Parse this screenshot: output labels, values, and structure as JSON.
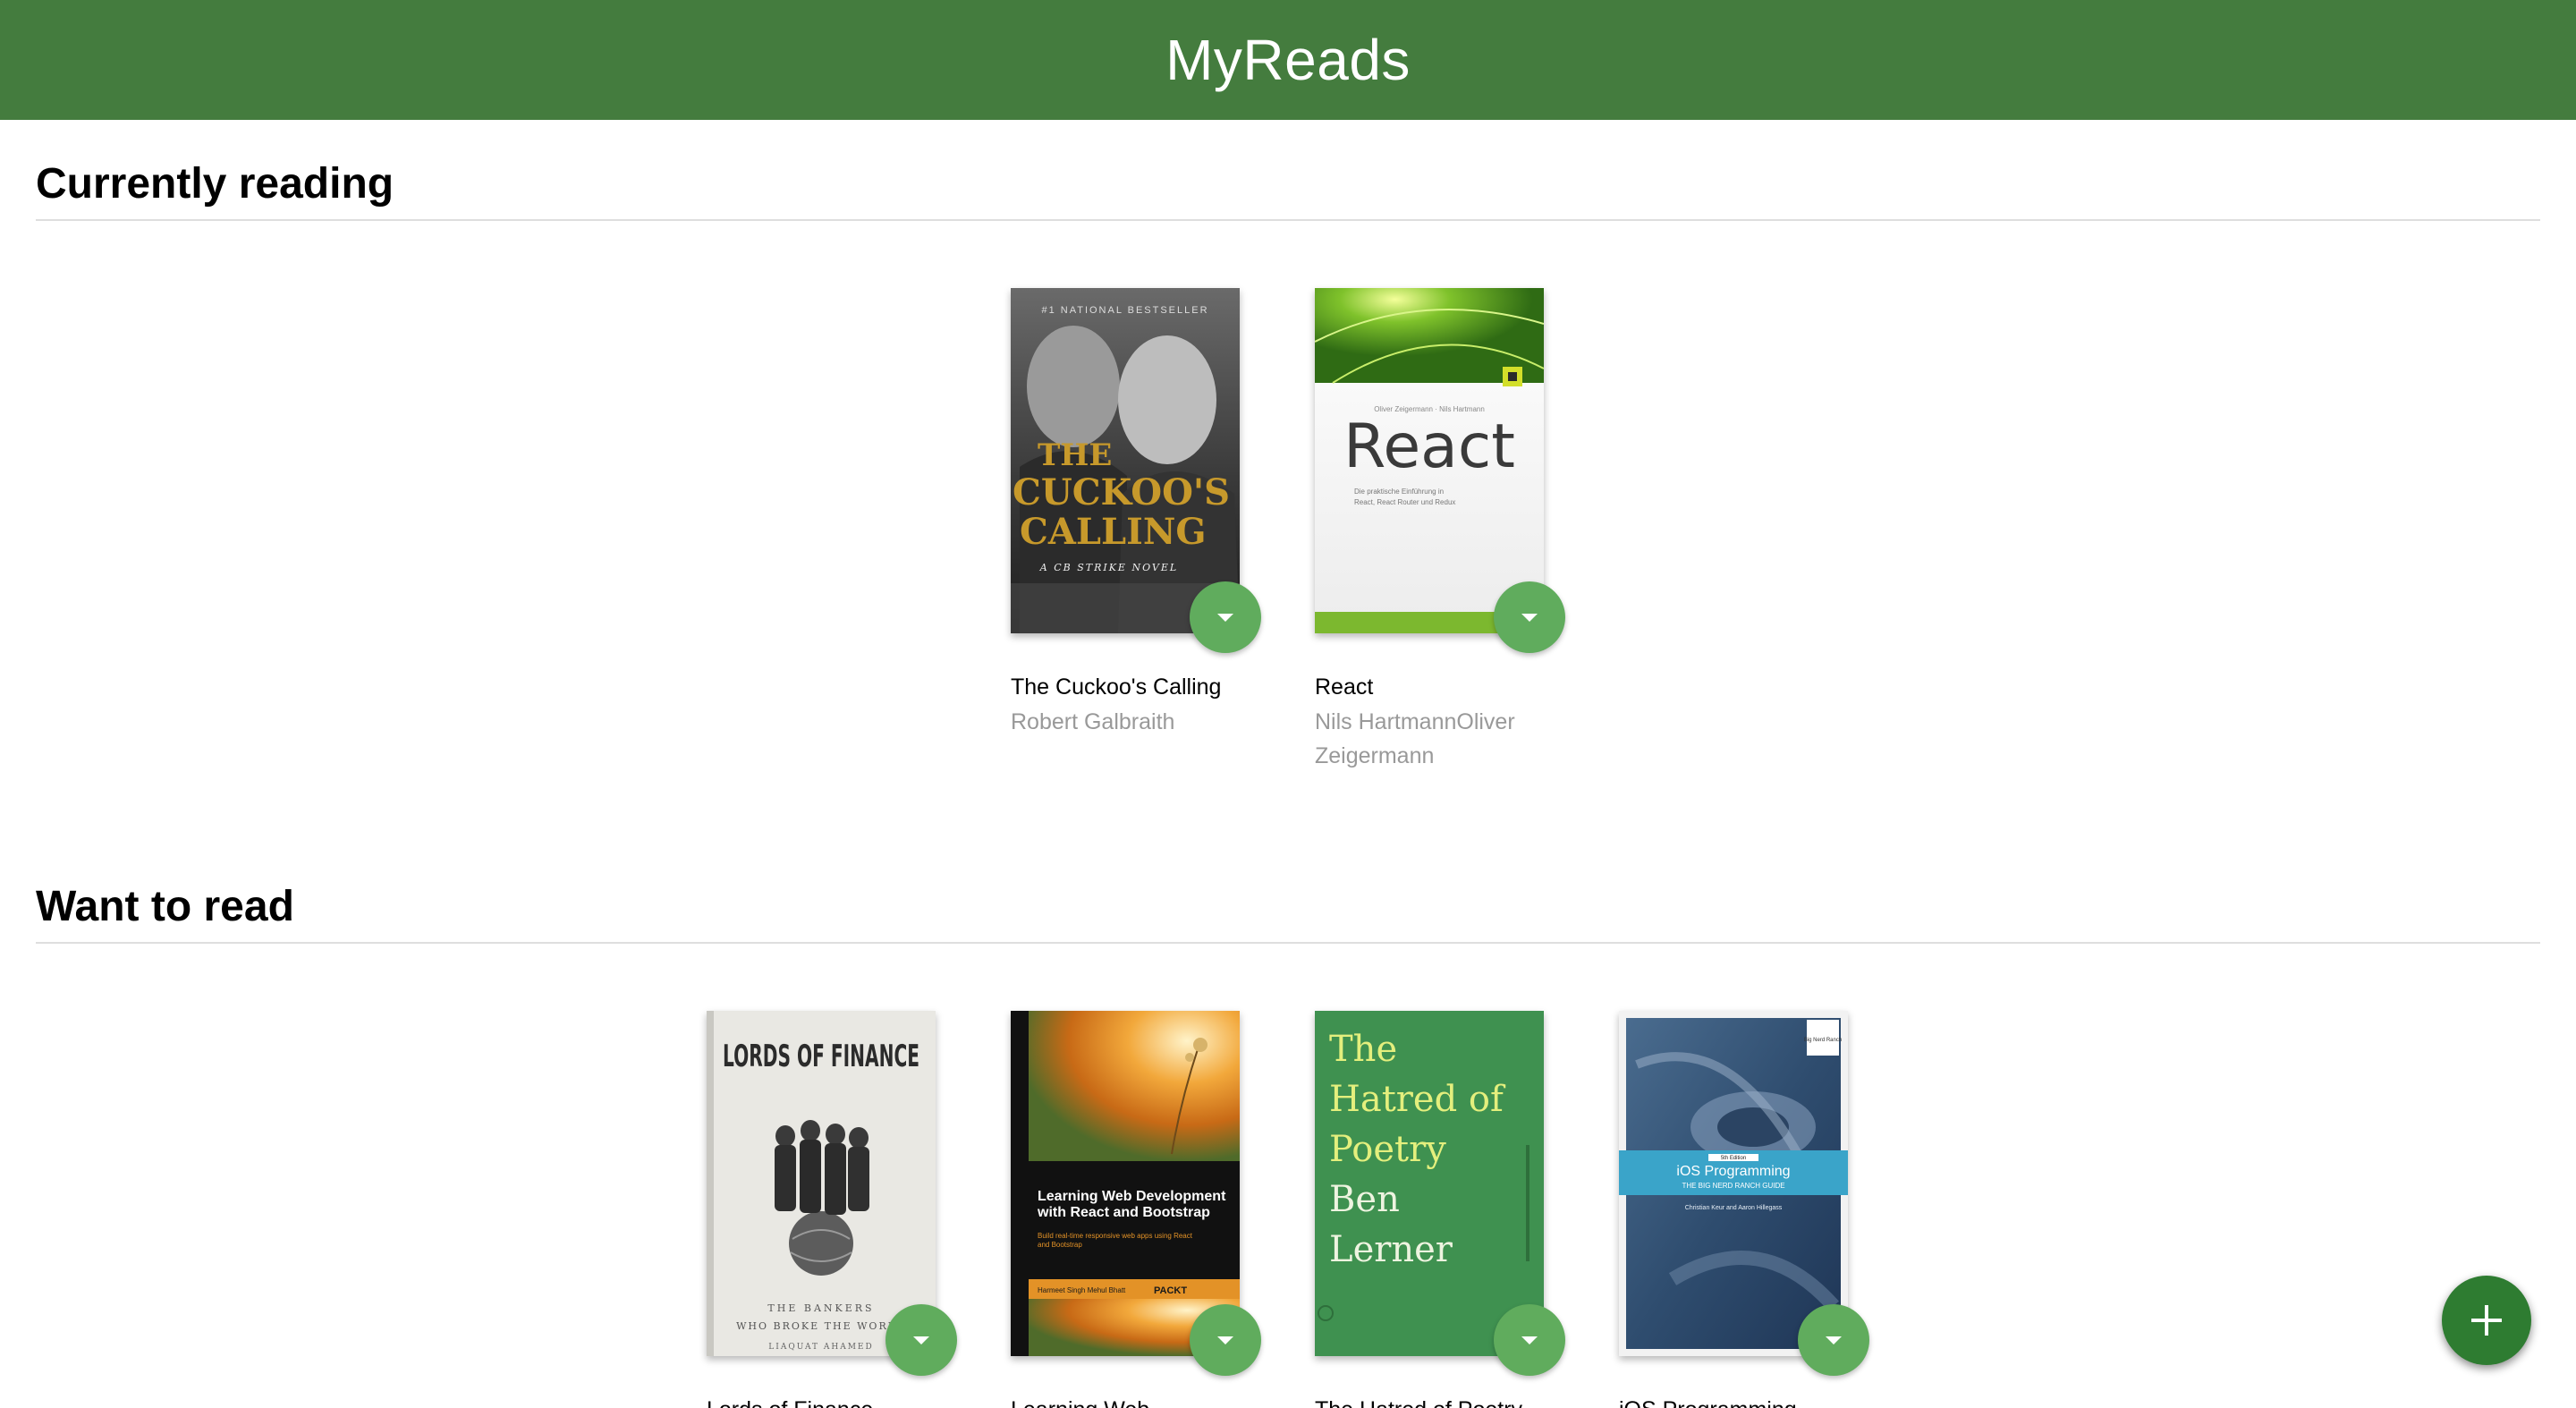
{
  "header": {
    "title": "MyReads"
  },
  "shelves": [
    {
      "title": "Currently reading",
      "books": [
        {
          "title": "The Cuckoo's Calling",
          "authors": "Robert Galbraith"
        },
        {
          "title": "React",
          "authors": "Nils HartmannOliver Zeigermann"
        }
      ]
    },
    {
      "title": "Want to read",
      "books": [
        {
          "title": "Lords of Finance",
          "authors": ""
        },
        {
          "title": "Learning Web",
          "authors": ""
        },
        {
          "title": "The Hatred of Poetry",
          "authors": ""
        },
        {
          "title": "iOS Programming",
          "authors": ""
        }
      ]
    }
  ],
  "covers": {
    "cuckoo": {
      "badge": "#1 NATIONAL BESTSELLER",
      "line1": "THE",
      "line2": "CUCKOO'S",
      "line3": "CALLING",
      "sub": "A CB STRIKE NOVEL"
    },
    "react": {
      "authors_line": "Oliver Zeigermann · Nils Hartmann",
      "title": "React",
      "sub1": "Die praktische Einführung in",
      "sub2": "React, React Router und Redux"
    },
    "lords": {
      "title": "LORDS OF FINANCE",
      "sub1": "THE BANKERS",
      "sub2": "WHO BROKE THE WORLD",
      "author": "LIAQUAT AHAMED"
    },
    "learning": {
      "title1": "Learning Web Development",
      "title2": "with React and Bootstrap",
      "sub1": "Build real-time responsive web apps using React",
      "sub2": "and Bootstrap",
      "authors": "Harmeet Singh  Mehul Bhatt",
      "publisher": "PACKT"
    },
    "hatred": {
      "line1": "The",
      "line2": "Hatred of",
      "line3": "Poetry",
      "line4": "Ben",
      "line5": "Lerner"
    },
    "ios": {
      "edition": "5th Edition",
      "title": "iOS Programming",
      "sub": "THE BIG NERD RANCH GUIDE",
      "authors": "Christian Keur and Aaron Hillegass",
      "logo": "Big Nerd Ranch"
    }
  },
  "colors": {
    "header": "#447c3e",
    "shelf_changer": "#60ac5d",
    "add_button": "#2e7c31"
  },
  "icons": {
    "shelf_changer": "caret-down-icon",
    "add": "plus-icon"
  }
}
